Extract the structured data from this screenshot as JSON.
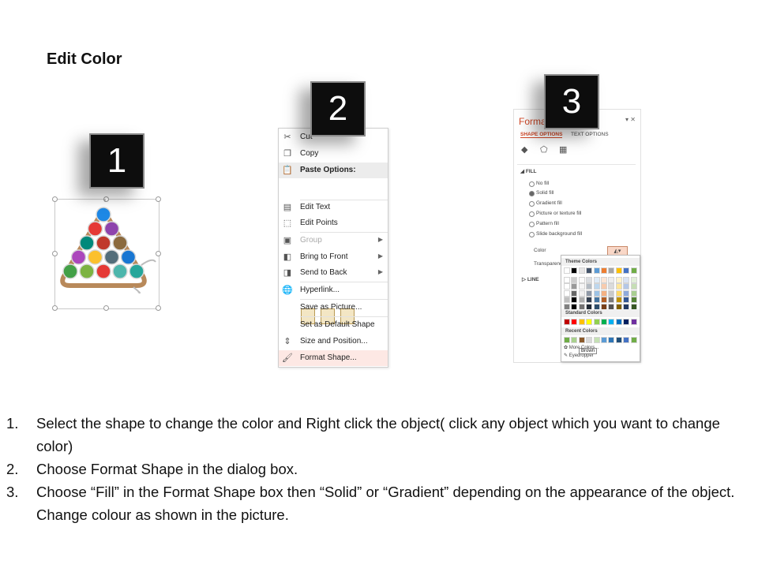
{
  "slide": {
    "title": "Edit Color",
    "badges": [
      "1",
      "2",
      "3"
    ]
  },
  "icons": {
    "cut": "scissors-icon",
    "copy": "copy-icon",
    "paste": "clipboard-icon",
    "edit_text": "text-box-icon",
    "edit_points": "edit-points-icon",
    "group": "group-icon",
    "bring_front": "bring-to-front-icon",
    "send_back": "send-to-back-icon",
    "hyperlink": "globe-link-icon",
    "size_position": "size-position-icon",
    "format_shape": "paint-brush-icon"
  },
  "context_menu": {
    "items": [
      {
        "label": "Cut",
        "disabled": false
      },
      {
        "label": "Copy",
        "disabled": false
      },
      {
        "label": "Paste Options:",
        "section": true
      },
      {
        "label": "Edit Text",
        "disabled": false
      },
      {
        "label": "Edit Points",
        "disabled": false
      },
      {
        "label": "Group",
        "disabled": true,
        "submenu": true
      },
      {
        "label": "Bring to Front",
        "disabled": false,
        "submenu": true
      },
      {
        "label": "Send to Back",
        "disabled": false,
        "submenu": true
      },
      {
        "label": "Hyperlink...",
        "disabled": false
      },
      {
        "label": "Save as Picture...",
        "disabled": false
      },
      {
        "label": "Set as Default Shape",
        "disabled": false
      },
      {
        "label": "Size and Position...",
        "disabled": false
      },
      {
        "label": "Format Shape...",
        "highlighted": true
      }
    ]
  },
  "format_pane": {
    "title": "Forma",
    "tabs": [
      "SHAPE OPTIONS",
      "TEXT OPTIONS"
    ],
    "fill_header": "FILL",
    "fill_options": [
      "No fill",
      "Solid fill",
      "Gradient fill",
      "Picture or texture fill",
      "Pattern fill",
      "Slide background fill"
    ],
    "selected_fill": "Solid fill",
    "color_label": "Color",
    "transparency_label": "Transparenc",
    "line_header": "LINE",
    "palette": {
      "theme_label": "Theme Colors",
      "standard_label": "Standard Colors",
      "recent_label": "Recent Colors",
      "more_label": "More Colors...",
      "eyedropper_label": "Eyedropper",
      "tooltip": "Brown"
    }
  },
  "colors": {
    "accent": "#d24726",
    "theme_row": [
      "#ffffff",
      "#000000",
      "#e7e6e6",
      "#44546a",
      "#5b9bd5",
      "#ed7d31",
      "#a5a5a5",
      "#ffc000",
      "#4472c4",
      "#70ad47"
    ],
    "standard_row": [
      "#c00000",
      "#ff0000",
      "#ffc000",
      "#ffff00",
      "#92d050",
      "#00b050",
      "#00b0f0",
      "#0070c0",
      "#002060",
      "#7030a0"
    ],
    "recent_row": [
      "#70ad47",
      "#a9d18e",
      "#8b5a2b",
      "#d9d9d9",
      "#c5e0b4",
      "#5b9bd5",
      "#2e75b6",
      "#1f4e79",
      "#4472c4",
      "#70ad47"
    ],
    "balls": [
      "#1e88e5",
      "#e53935",
      "#8e44ad",
      "#00897b",
      "#c0392b",
      "#8b6a3e",
      "#ab47bc",
      "#fbc02d",
      "#546e7a",
      "#1976d2",
      "#43a047",
      "#7cb342",
      "#e53935",
      "#4db6ac",
      "#26a69a"
    ]
  },
  "instructions": [
    {
      "num": "1.",
      "text": "Select the shape to change the color and Right click the object( click any object which you want to change color)"
    },
    {
      "num": "2.",
      "text": "Choose Format Shape in the dialog box."
    },
    {
      "num": "3.",
      "text": "Choose “Fill” in the Format Shape box then “Solid” or “Gradient” depending on the appearance of the object. Change colour as shown in the picture."
    }
  ]
}
